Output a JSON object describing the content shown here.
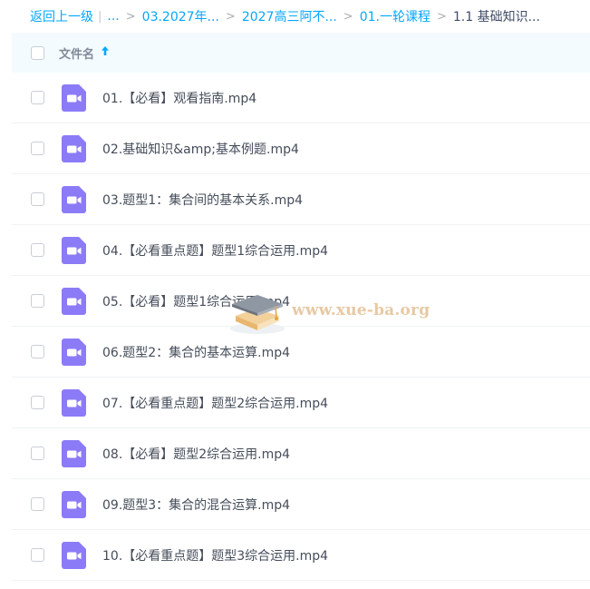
{
  "breadcrumb": {
    "back_label": "返回上一级",
    "divider": "|",
    "ellipsis": "...",
    "separator": ">",
    "crumbs": [
      "03.2027年...",
      "2027高三阿不...",
      "01.一轮课程"
    ],
    "current": "1.1 基础知识..."
  },
  "header": {
    "column_name": "文件名",
    "sort_icon": "arrow-up-icon"
  },
  "file_icon": "video-file-icon",
  "colors": {
    "link": "#06a7ff",
    "header_bg": "#f4fbff",
    "video_icon": "#8c7bf7"
  },
  "files": [
    {
      "name": "01.【必看】观看指南.mp4"
    },
    {
      "name": "02.基础知识&amp;基本例题.mp4"
    },
    {
      "name": "03.题型1：集合间的基本关系.mp4"
    },
    {
      "name": "04.【必看重点题】题型1综合运用.mp4"
    },
    {
      "name": "05.【必看】题型1综合运用.mp4"
    },
    {
      "name": "06.题型2：集合的基本运算.mp4"
    },
    {
      "name": "07.【必看重点题】题型2综合运用.mp4"
    },
    {
      "name": "08.【必看】题型2综合运用.mp4"
    },
    {
      "name": "09.题型3：集合的混合运算.mp4"
    },
    {
      "name": "10.【必看重点题】题型3综合运用.mp4"
    }
  ],
  "watermark": {
    "text": "www.xue-ba.org"
  }
}
